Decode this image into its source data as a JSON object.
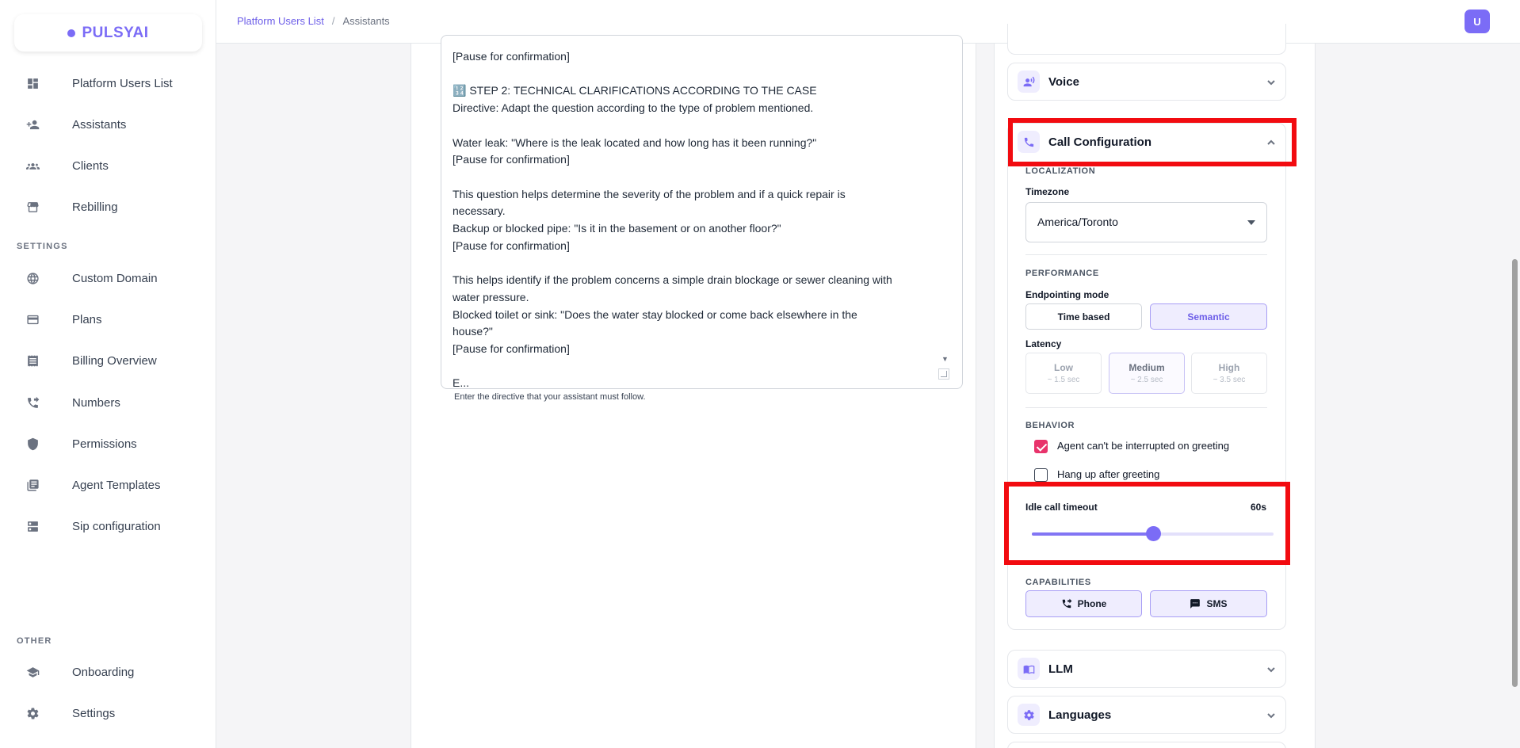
{
  "app": {
    "logo_text": "PULSYAI",
    "avatar_initial": "U"
  },
  "sidebar": {
    "main_items": [
      {
        "label": "Platform Users List",
        "icon": "dashboard-icon"
      },
      {
        "label": "Assistants",
        "icon": "person-add-icon"
      },
      {
        "label": "Clients",
        "icon": "group-icon"
      },
      {
        "label": "Rebilling",
        "icon": "storefront-icon"
      }
    ],
    "settings_title": "SETTINGS",
    "settings_items": [
      {
        "label": "Custom Domain",
        "icon": "globe-icon"
      },
      {
        "label": "Plans",
        "icon": "credit-card-icon"
      },
      {
        "label": "Billing Overview",
        "icon": "receipt-icon"
      },
      {
        "label": "Numbers",
        "icon": "phone-forward-icon"
      },
      {
        "label": "Permissions",
        "icon": "shield-icon"
      },
      {
        "label": "Agent Templates",
        "icon": "library-icon"
      },
      {
        "label": "Sip configuration",
        "icon": "server-icon"
      }
    ],
    "other_title": "OTHER",
    "other_items": [
      {
        "label": "Onboarding",
        "icon": "graduation-cap-icon"
      },
      {
        "label": "Settings",
        "icon": "gear-icon"
      }
    ]
  },
  "header": {
    "breadcrumb": {
      "link": "Platform Users List",
      "separator": "/",
      "current": "Assistants"
    }
  },
  "prompt": {
    "lines": [
      "[Pause for confirmation]",
      "",
      "🔢 STEP 2: TECHNICAL CLARIFICATIONS ACCORDING TO THE CASE",
      "Directive: Adapt the question according to the type of problem mentioned.",
      "",
      "Water leak: \"Where is the leak located and how long has it been running?\"",
      "[Pause for confirmation]",
      "",
      "This question helps determine the severity of the problem and if a quick repair is",
      "necessary.",
      "Backup or blocked pipe: \"Is it in the basement or on another floor?\"",
      "[Pause for confirmation]",
      "",
      "This helps identify if the problem concerns a simple drain blockage or sewer cleaning with",
      "water pressure.",
      "Blocked toilet or sink: \"Does the water stay blocked or come back elsewhere in the",
      "house?\"",
      "[Pause for confirmation]",
      "",
      "E..."
    ],
    "helper": "Enter the directive that your assistant must follow."
  },
  "panel": {
    "voice": {
      "title": "Voice",
      "icon": "voice-icon"
    },
    "call_config": {
      "title": "Call Configuration",
      "icon": "phone-icon",
      "localization_title": "LOCALIZATION",
      "timezone_label": "Timezone",
      "timezone_value": "America/Toronto",
      "performance_title": "PERFORMANCE",
      "endpointing_label": "Endpointing mode",
      "endpointing_options": [
        "Time based",
        "Semantic"
      ],
      "endpointing_selected": "Semantic",
      "latency_label": "Latency",
      "latency_options": [
        {
          "name": "Low",
          "sub": "~ 1.5 sec"
        },
        {
          "name": "Medium",
          "sub": "~ 2.5 sec"
        },
        {
          "name": "High",
          "sub": "~ 3.5 sec"
        }
      ],
      "latency_selected": "Medium",
      "behavior_title": "BEHAVIOR",
      "behavior_options": [
        {
          "label": "Agent can't be interrupted on greeting",
          "checked": true
        },
        {
          "label": "Hang up after greeting",
          "checked": false
        }
      ],
      "idle_timeout_label": "Idle call timeout",
      "idle_timeout_value": "60s",
      "idle_timeout_fraction": 0.5,
      "capabilities_title": "CAPABILITIES",
      "capabilities": [
        {
          "label": "Phone",
          "icon": "phone-forward-icon"
        },
        {
          "label": "SMS",
          "icon": "chat-icon"
        }
      ]
    },
    "llm": {
      "title": "LLM",
      "icon": "book-icon"
    },
    "languages": {
      "title": "Languages",
      "icon": "gear-icon"
    }
  },
  "colors": {
    "accent": "#7b6cf6",
    "highlight": "#f20b10",
    "checkbox": "#e8336b"
  }
}
